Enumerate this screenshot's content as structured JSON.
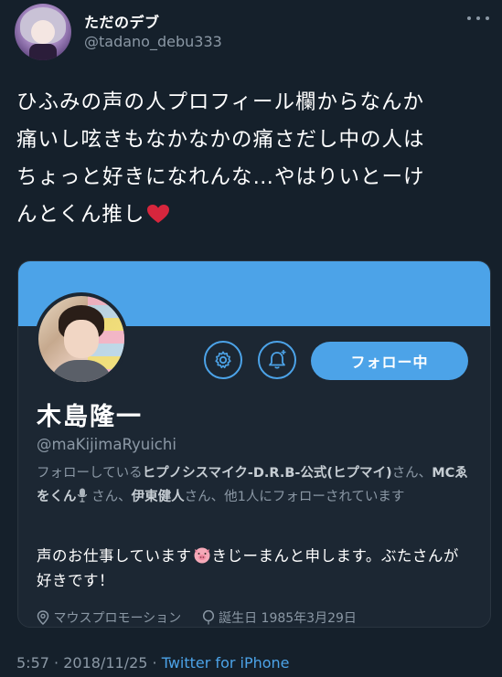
{
  "tweet": {
    "display_name": "ただのデブ",
    "handle": "@tadano_debu333",
    "text": "ひふみの声の人プロフィール欄からなんか\n痛いし呟きもなかなかの痛さだし中の人は\nちょっと好きになれんな…やはりいとーけ\nんとくん推し",
    "heart_emoji": "heart",
    "time": "5:57",
    "date": "2018/11/25",
    "separator": "·",
    "source": "Twitter for iPhone"
  },
  "card": {
    "name": "木島隆一",
    "handle": "@maKijimaRyuichi",
    "follow_button": "フォロー中",
    "followed_by": {
      "prefix": "フォローしている",
      "user1": "ヒプノシスマイク-D.R.B-公式(ヒプマイ)",
      "sep1": "さん、",
      "user2": "MCゑをくん",
      "sep2": "さん、",
      "user3": "伊東健人",
      "suffix": "さん、他1人にフォローされています"
    },
    "bio_part1": "声のお仕事しています",
    "bio_part2": "きじーまんと申します。ぶたさんが好きです！",
    "location": "マウスプロモーション",
    "birthday": "誕生日 1985年3月29日"
  },
  "colors": {
    "background": "#15202b",
    "card": "#1c2733",
    "accent": "#4ca3e8",
    "muted": "#8b98a5"
  }
}
